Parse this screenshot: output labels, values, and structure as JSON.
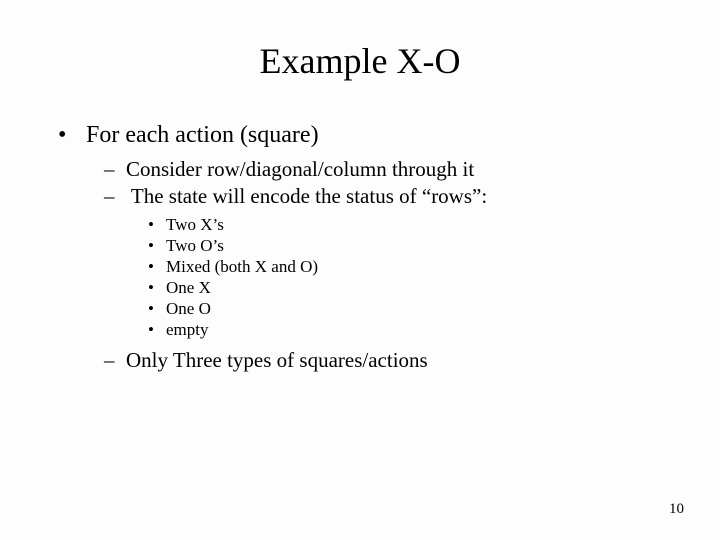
{
  "title": "Example X-O",
  "bullet_main": "For each action (square)",
  "sub": {
    "a": "Consider row/diagonal/column through it",
    "b": "The state will encode the status of “rows”:",
    "c": "Only Three types of squares/actions"
  },
  "states": {
    "s1": "Two X’s",
    "s2": "Two O’s",
    "s3": "Mixed (both X and O)",
    "s4": "One X",
    "s5": "One O",
    "s6": "empty"
  },
  "page_number": "10"
}
